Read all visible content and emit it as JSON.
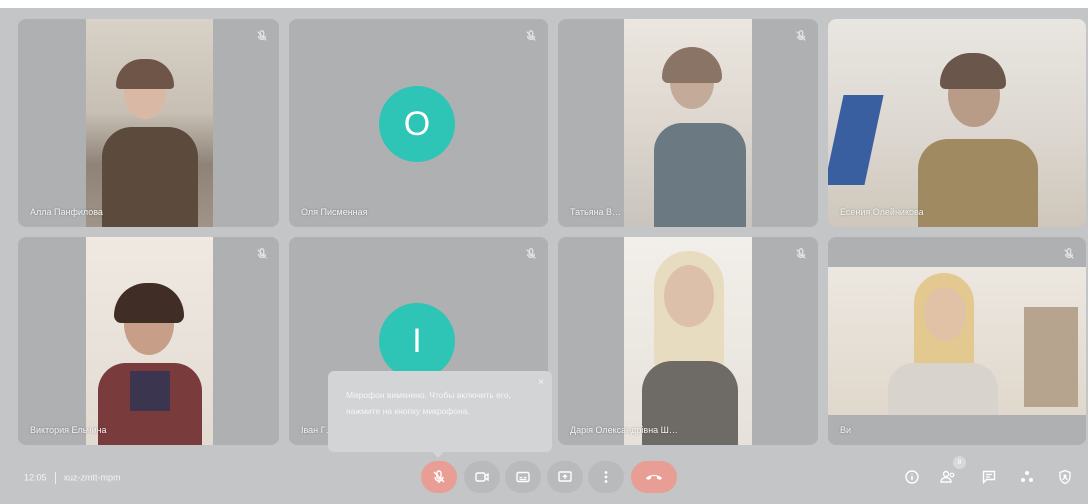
{
  "participants": [
    {
      "name": "Алла Панфилова"
    },
    {
      "name": "Оля Писменная",
      "avatar_letter": "О"
    },
    {
      "name": "Татьяна В…"
    },
    {
      "name": "Есения Олейникова"
    },
    {
      "name": "Виктория Ельчина"
    },
    {
      "name": "Іван Г…",
      "avatar_letter": "І"
    },
    {
      "name": "Дарія Олександрівна Ш…"
    },
    {
      "name": "Ви"
    }
  ],
  "tooltip": {
    "text": "Мікрофон вимкнено. Чтобы включить его, нажмите на кнопку микрофона.",
    "close": "×"
  },
  "meeting": {
    "time": "12:05",
    "code": "xuz-zmtt-mpm"
  },
  "controls": [
    "mic-off",
    "camera",
    "captions",
    "present",
    "more",
    "end-call"
  ],
  "right_controls": [
    "info",
    "people",
    "chat",
    "activities",
    "security"
  ],
  "people_count": "8",
  "colors": {
    "avatar": "#2ec4b6",
    "end_call": "#e89e94",
    "tile": "#aeb0b2",
    "background": "#c3c5c7"
  }
}
